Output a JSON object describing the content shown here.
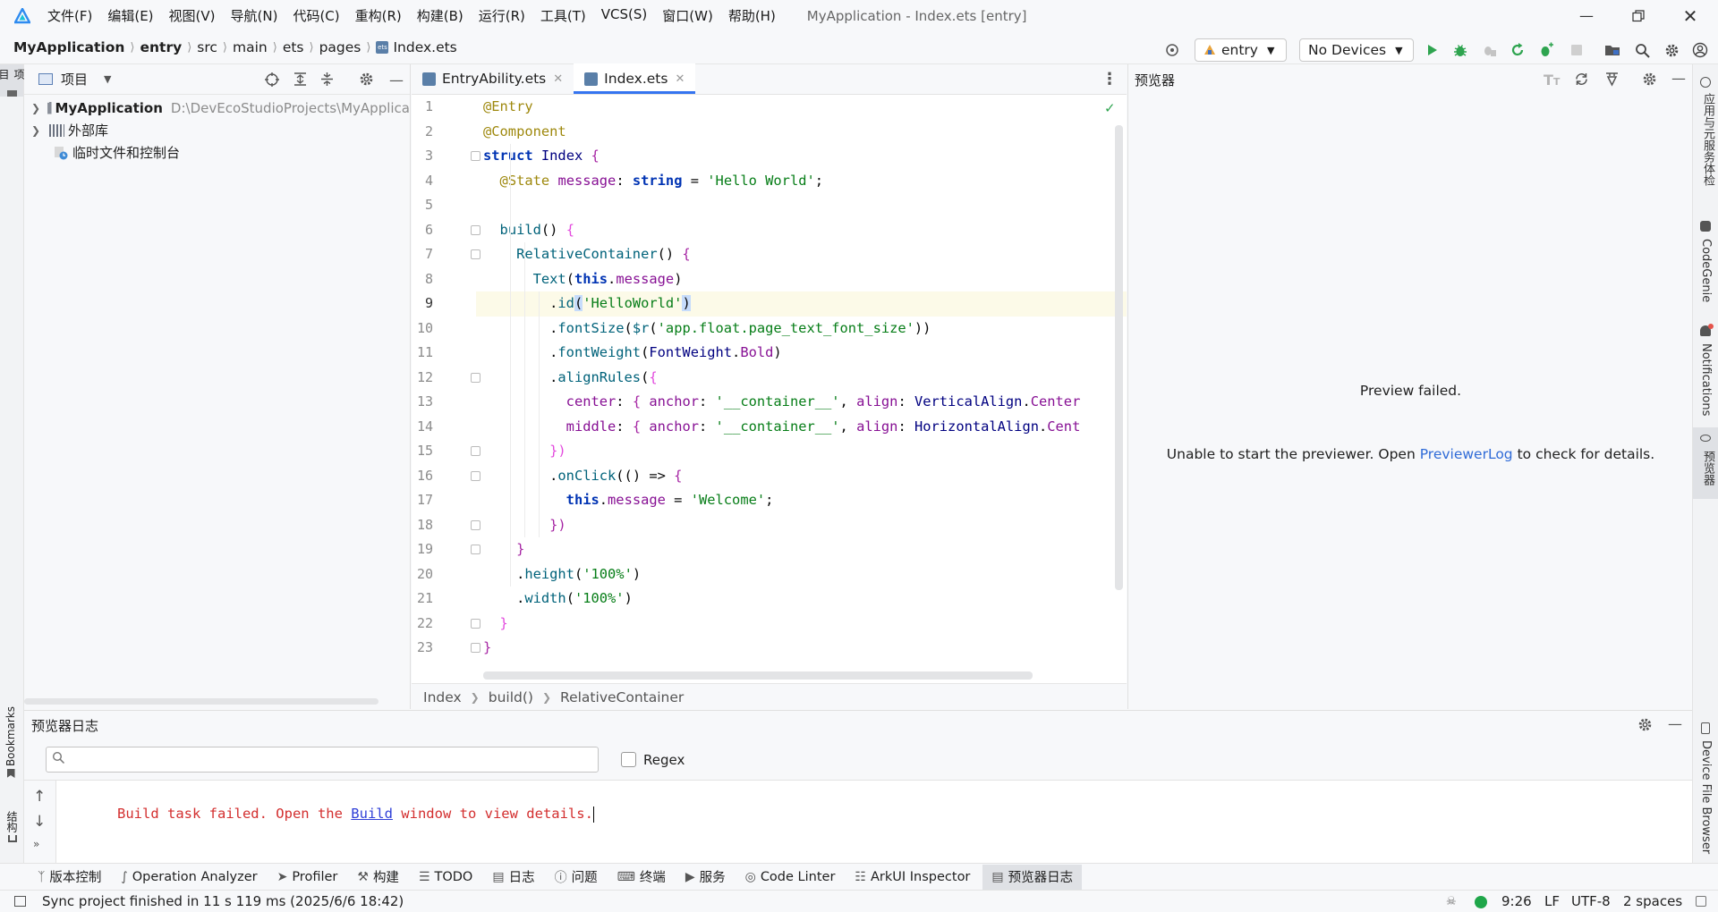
{
  "titlebar": {
    "menus": [
      "文件(F)",
      "编辑(E)",
      "视图(V)",
      "导航(N)",
      "代码(C)",
      "重构(R)",
      "构建(B)",
      "运行(R)",
      "工具(T)",
      "VCS(S)",
      "窗口(W)",
      "帮助(H)"
    ],
    "window_title": "MyApplication - Index.ets [entry]"
  },
  "navbar": {
    "breadcrumbs": [
      "MyApplication",
      "entry",
      "src",
      "main",
      "ets",
      "pages",
      "Index.ets"
    ],
    "run_config": "entry",
    "device": "No Devices"
  },
  "project": {
    "header": "项目",
    "items": [
      {
        "name": "MyApplication",
        "path": "D:\\DevEcoStudioProjects\\MyApplica"
      },
      {
        "name": "外部库",
        "path": ""
      },
      {
        "name": "临时文件和控制台",
        "path": ""
      }
    ],
    "strip_label": "项目"
  },
  "editor": {
    "tabs": [
      {
        "label": "EntryAbility.ets",
        "active": false
      },
      {
        "label": "Index.ets",
        "active": true
      }
    ],
    "breadcrumbs": [
      "Index",
      "build()",
      "RelativeContainer"
    ],
    "current_line": 9
  },
  "preview": {
    "header": "预览器",
    "failed_title": "Preview failed.",
    "message_before": "Unable to start the previewer. Open ",
    "message_link": "PreviewerLog",
    "message_after": " to check for details."
  },
  "right_strip": [
    "应用与元服务体检",
    "CodeGenie",
    "Notifications",
    "预览器",
    "Device File Browser"
  ],
  "left_strip_bottom": [
    "Bookmarks",
    "结构"
  ],
  "log": {
    "title": "预览器日志",
    "search_placeholder": "",
    "regex_label": "Regex",
    "line_before": "Build task failed. Open the ",
    "line_link": "Build",
    "line_after": " window to view details."
  },
  "tool_windows": [
    "版本控制",
    "Operation Analyzer",
    "Profiler",
    "构建",
    "TODO",
    "日志",
    "问题",
    "终端",
    "服务",
    "Code Linter",
    "ArkUI Inspector",
    "预览器日志"
  ],
  "statusbar": {
    "message": "Sync project finished in 11 s 119 ms (2025/6/6 18:42)",
    "position": "9:26",
    "line_sep": "LF",
    "encoding": "UTF-8",
    "indent": "2 spaces"
  }
}
